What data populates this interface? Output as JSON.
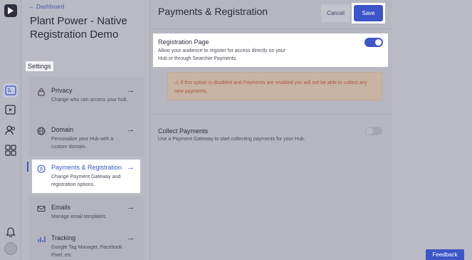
{
  "nav": {
    "back_label": "Dashboard",
    "hub_title": "Plant Power - Native Registration Demo",
    "settings_label": "Settings",
    "items": [
      {
        "title": "Privacy",
        "desc": "Change who can access your hub.",
        "icon": "lock-icon"
      },
      {
        "title": "Domain",
        "desc": "Personalize your Hub with a custom domain.",
        "icon": "globe-icon"
      },
      {
        "title": "Payments & Registration",
        "desc": "Change Payment Gateway and registration options.",
        "icon": "dollar-icon"
      },
      {
        "title": "Emails",
        "desc": "Manage email templates.",
        "icon": "mail-icon"
      },
      {
        "title": "Tracking",
        "desc": "Google Tag Manager, Facebook Pixel, etc.",
        "icon": "chart-icon"
      }
    ],
    "arrow": "→"
  },
  "header": {
    "title": "Payments & Registration",
    "cancel_label": "Cancel",
    "save_label": "Save"
  },
  "registration": {
    "title": "Registration Page",
    "desc": "Allow your audience to register for access directly on your Hub or through Searchie Payments.",
    "enabled": true
  },
  "warning": {
    "text": "If this option is disabled and Payments are enabled you will not be able to collect any new payments."
  },
  "collect": {
    "title": "Collect Payments",
    "desc": "Use a Payment Gateway to start collecting payments for your Hub.",
    "enabled": false
  },
  "feedback_label": "Feedback",
  "colors": {
    "accent": "#3c55c8",
    "warning_text": "#a65b3e",
    "overlay_bg": "#b9bac3"
  }
}
